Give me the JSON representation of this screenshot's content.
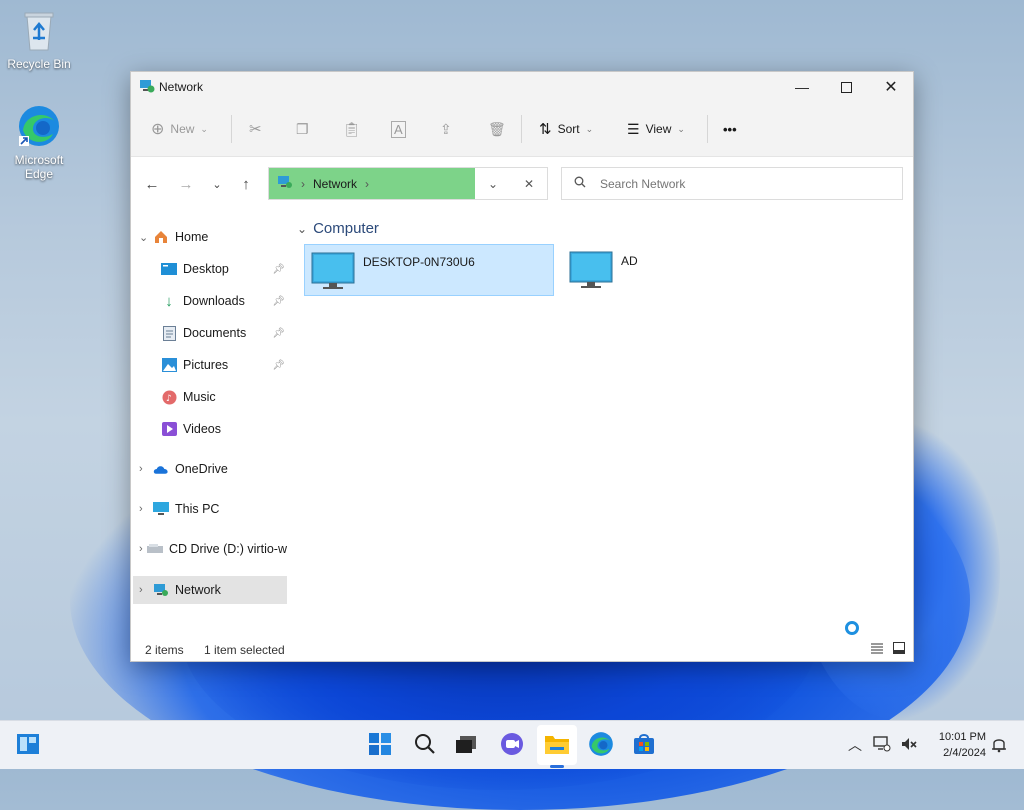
{
  "desktop": {
    "icons": [
      {
        "label": "Recycle Bin"
      },
      {
        "label": "Microsoft Edge"
      }
    ]
  },
  "window": {
    "title": "Network",
    "toolbar": {
      "new_label": "New",
      "sort_label": "Sort",
      "view_label": "View",
      "more_label": "•••"
    },
    "address": {
      "segment": "Network",
      "sep": "›"
    },
    "search": {
      "placeholder": "Search Network"
    },
    "sidebar": {
      "items": [
        {
          "label": "Home",
          "icon": "home-icon"
        },
        {
          "label": "Desktop",
          "icon": "desktop-folder-icon",
          "pinned": true
        },
        {
          "label": "Downloads",
          "icon": "download-icon",
          "pinned": true
        },
        {
          "label": "Documents",
          "icon": "documents-icon",
          "pinned": true
        },
        {
          "label": "Pictures",
          "icon": "pictures-icon",
          "pinned": true
        },
        {
          "label": "Music",
          "icon": "music-icon"
        },
        {
          "label": "Videos",
          "icon": "videos-icon"
        },
        {
          "label": "OneDrive",
          "icon": "onedrive-icon"
        },
        {
          "label": "This PC",
          "icon": "pc-icon"
        },
        {
          "label": "CD Drive (D:) virtio-w",
          "icon": "cd-drive-icon"
        },
        {
          "label": "Network",
          "icon": "network-icon"
        }
      ]
    },
    "content": {
      "group": "Computer",
      "items": [
        {
          "name": "DESKTOP-0N730U6",
          "selected": true
        },
        {
          "name": "AD",
          "selected": false
        }
      ]
    },
    "status": {
      "count": "2 items",
      "selection": "1 item selected"
    }
  },
  "taskbar": {
    "time": "10:01 PM",
    "date": "2/4/2024"
  },
  "colors": {
    "accent": "#2a6fdb",
    "address_highlight": "#7dd389",
    "selection": "#cce8ff"
  }
}
